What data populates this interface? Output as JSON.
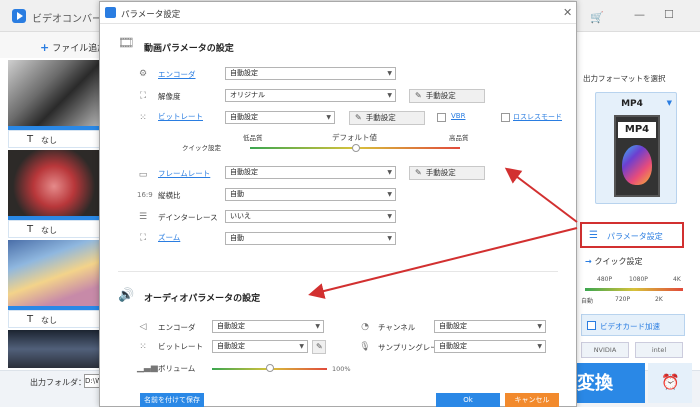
{
  "app": {
    "title": "ビデオコンバーター",
    "add_file": "ファイル追加",
    "subtitle_label": "なし",
    "output_folder_label": "出力フォルダ：",
    "output_folder_value": "D:\\WF"
  },
  "right_panel": {
    "format_title": "出力フォーマットを選択",
    "format_name": "MP4",
    "format_badge": "MP4",
    "param_button": "パラメータ設定",
    "quick_title": "クイック設定",
    "quick_labels_top": [
      "480P",
      "1080P",
      "4K"
    ],
    "quick_labels_bottom": [
      "自動",
      "720P",
      "2K"
    ],
    "gpu_accel": "ビデオカード加速",
    "vendors": [
      "NVIDIA",
      "intel"
    ],
    "convert_label": "変換"
  },
  "dialog": {
    "title": "パラメータ設定",
    "video_section_title": "動画パラメータの設定",
    "audio_section_title": "オーディオパラメータの設定",
    "video": {
      "encoder_label": "エンコーダ",
      "encoder_value": "自動設定",
      "resolution_label": "解像度",
      "resolution_value": "オリジナル",
      "resolution_manual": "手動設定",
      "bitrate_label": "ビットレート",
      "bitrate_value": "自動設定",
      "bitrate_manual": "手動設定",
      "vbr_label": "VBR",
      "lossless_label": "ロスレスモード",
      "quick_setting_label": "クイック設定",
      "quality_low": "低品質",
      "quality_default": "デフォルト値",
      "quality_high": "高品質",
      "framerate_label": "フレームレート",
      "framerate_value": "自動設定",
      "framerate_manual": "手動設定",
      "aspect_label": "縦横比",
      "aspect_value": "自動",
      "deinterlace_label": "デインターレース",
      "deinterlace_value": "いいえ",
      "zoom_label": "ズーム",
      "zoom_value": "自動"
    },
    "audio": {
      "encoder_label": "エンコーダ",
      "encoder_value": "自動設定",
      "channel_label": "チャンネル",
      "channel_value": "自動設定",
      "bitrate_label": "ビットレート",
      "bitrate_value": "自動設定",
      "samplerate_label": "サンプリングレート",
      "samplerate_value": "自動設定",
      "volume_label": "ボリューム",
      "volume_value": "100%"
    },
    "footer": {
      "save_as": "名前を付けて保存",
      "ok": "Ok",
      "cancel": "キャンセル"
    }
  },
  "colors": {
    "accent": "#2a88e6",
    "cancel": "#f28a2d",
    "arrow": "#d23030"
  }
}
